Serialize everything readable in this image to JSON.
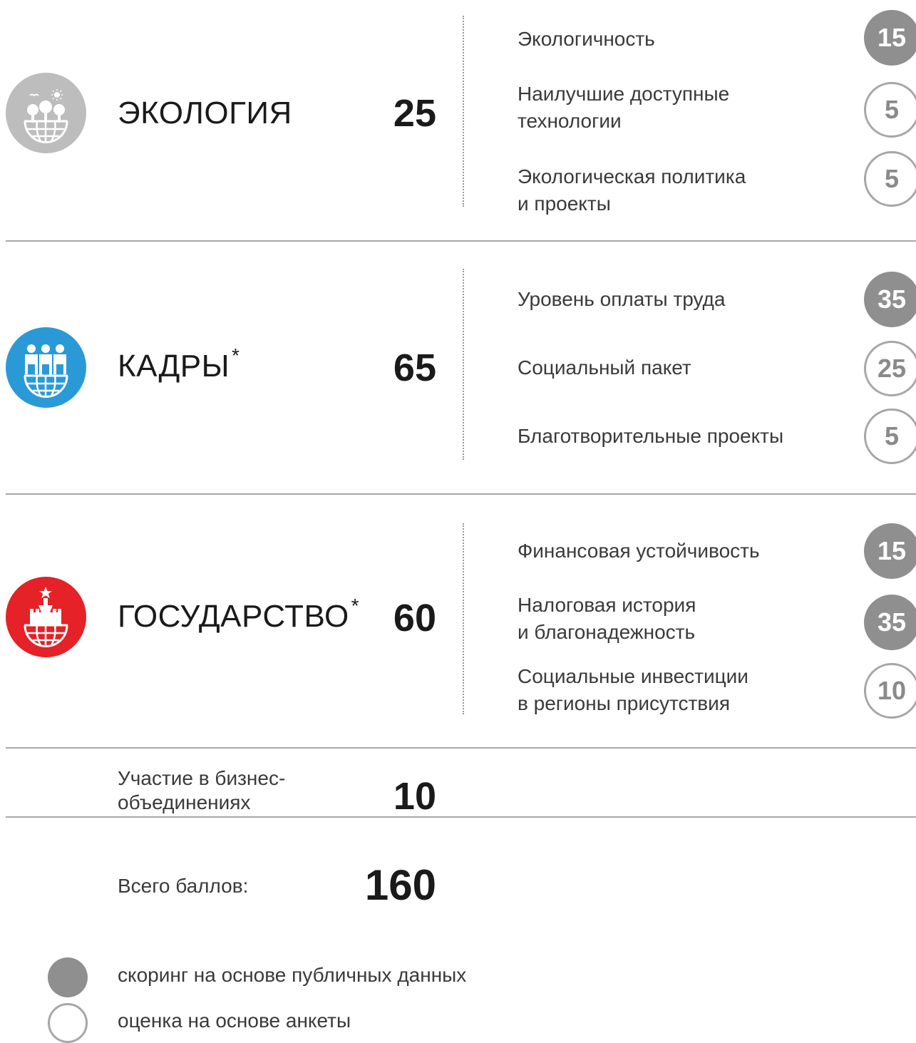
{
  "categories": [
    {
      "title": "ЭКОЛОГИЯ",
      "asterisk": "",
      "score": "25",
      "icon": "ecology-icon",
      "icon_color": "#bdbdbd",
      "items": [
        {
          "label": "Экологичность",
          "score": "15",
          "type": "filled"
        },
        {
          "label": "Наилучшие доступные\nтехнологии",
          "score": "5",
          "type": "outline"
        },
        {
          "label": "Экологическая политика\nи проекты",
          "score": "5",
          "type": "outline"
        }
      ]
    },
    {
      "title": "КАДРЫ",
      "asterisk": "*",
      "score": "65",
      "icon": "staff-icon",
      "icon_color": "#2a9ad6",
      "items": [
        {
          "label": "Уровень оплаты труда",
          "score": "35",
          "type": "filled"
        },
        {
          "label": "Социальный пакет",
          "score": "25",
          "type": "outline"
        },
        {
          "label": "Благотворительные проекты",
          "score": "5",
          "type": "outline"
        }
      ]
    },
    {
      "title": "ГОСУДАРСТВО",
      "asterisk": "*",
      "score": "60",
      "icon": "state-icon",
      "icon_color": "#e42227",
      "items": [
        {
          "label": "Финансовая устойчивость",
          "score": "15",
          "type": "filled"
        },
        {
          "label": "Налоговая история\nи благонадежность",
          "score": "35",
          "type": "filled"
        },
        {
          "label": "Социальные инвестиции\nв регионы присутствия",
          "score": "10",
          "type": "outline"
        }
      ]
    }
  ],
  "business": {
    "label": "Участие в бизнес-\nобъединениях",
    "score": "10"
  },
  "total": {
    "label": "Всего баллов:",
    "score": "160"
  },
  "legend": {
    "filled": "скоринг на основе публичных данных",
    "outline": "оценка на основе анкеты"
  },
  "colors": {
    "badge_filled": "#8f8f90",
    "badge_outline": "#a7a7a8",
    "divider": "#a8a8a8"
  }
}
